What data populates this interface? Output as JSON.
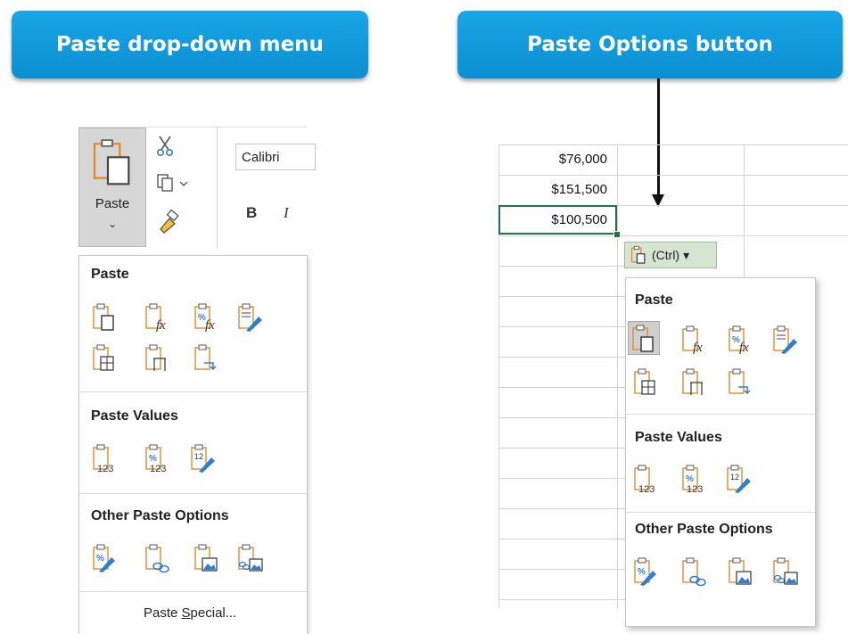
{
  "callouts": {
    "left": "Paste drop-down menu",
    "right": "Paste Options button"
  },
  "ribbon": {
    "paste_label": "Paste",
    "paste_chevron": "⌄",
    "font_name": "Calibri",
    "bold": "B",
    "italic": "I"
  },
  "menu": {
    "paste_title": "Paste",
    "values_title": "Paste Values",
    "other_title": "Other Paste Options",
    "special_label": "Paste Special...",
    "special_accel": "S"
  },
  "sheet": {
    "values": [
      "$76,000",
      "$151,500",
      "$100,500"
    ]
  },
  "paste_options": {
    "button_label": "(Ctrl)",
    "button_chevron": "▾"
  },
  "colors": {
    "callout": "#129ddd",
    "clipboard": "#e08b2e",
    "accent_blue": "#2f7fd0",
    "selection_green": "#217346"
  },
  "icons": {
    "paste_row1": [
      "paste-icon",
      "formulas-icon",
      "formulas-number-format-icon",
      "keep-source-formatting-icon"
    ],
    "paste_row2": [
      "no-borders-icon",
      "keep-column-widths-icon",
      "transpose-icon"
    ],
    "values_row": [
      "values-icon",
      "values-number-format-icon",
      "values-source-formatting-icon"
    ],
    "other_row": [
      "formatting-icon",
      "paste-link-icon",
      "picture-icon",
      "linked-picture-icon"
    ]
  }
}
